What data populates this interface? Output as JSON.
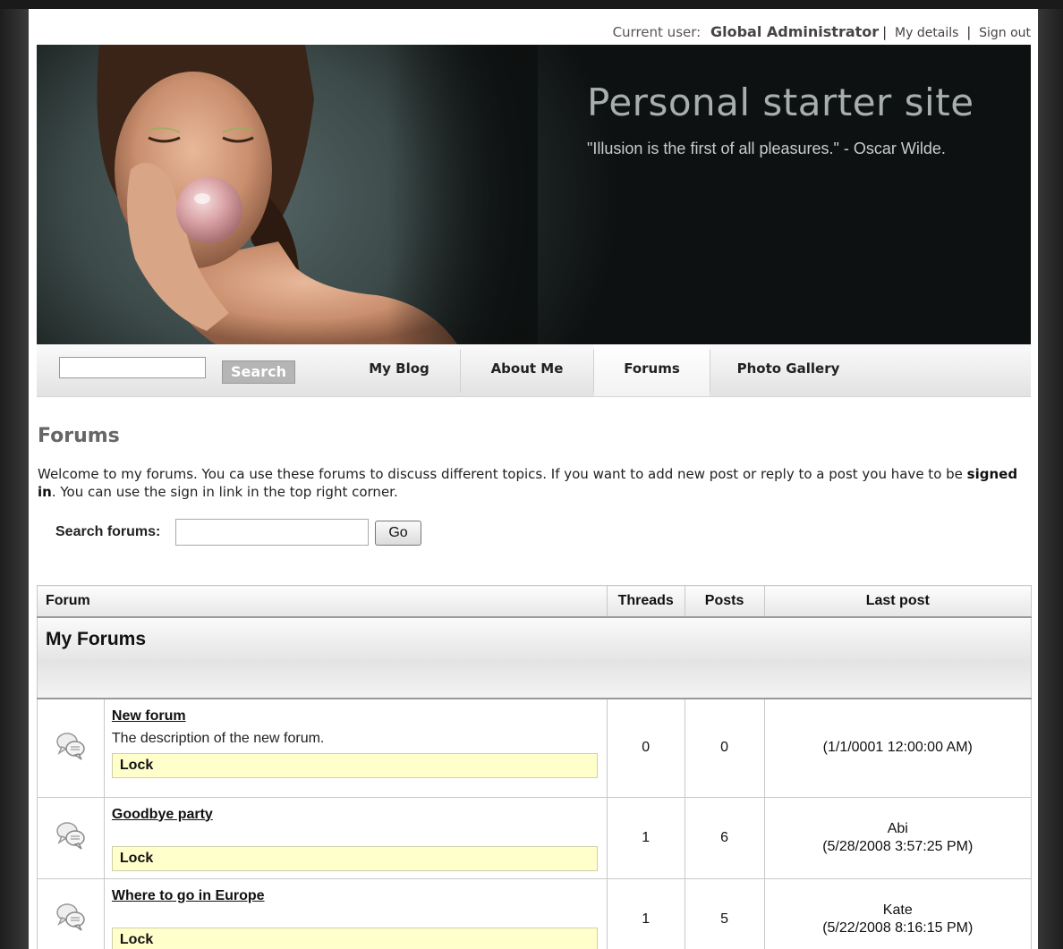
{
  "user_bar": {
    "current_user_label": "Current user:",
    "current_user_name": "Global Administrator",
    "my_details": "My details",
    "sign_out": "Sign out"
  },
  "banner": {
    "title": "Personal starter site",
    "quote": "\"Illusion is the first of all pleasures.\" - Oscar Wilde."
  },
  "nav": {
    "search_button": "Search",
    "items": [
      {
        "label": "My Blog"
      },
      {
        "label": "About Me"
      },
      {
        "label": "Forums"
      },
      {
        "label": "Photo Gallery"
      }
    ]
  },
  "page": {
    "heading": "Forums",
    "intro_pre": "Welcome to my forums. You ca use these forums to discuss different topics. If you want to add new post or reply to a post you have to be ",
    "intro_bold": "signed in",
    "intro_post": ". You can use the sign in link in the top right corner."
  },
  "search_forums": {
    "label": "Search forums:",
    "input_value": "",
    "go_button": "Go"
  },
  "table": {
    "headers": {
      "forum": "Forum",
      "threads": "Threads",
      "posts": "Posts",
      "last_post": "Last post"
    },
    "group": "My Forums",
    "rows": [
      {
        "name": "New forum",
        "description": "The description of the new forum.",
        "lock": "Lock",
        "threads": "0",
        "posts": "0",
        "last_user": "",
        "last_date": "(1/1/0001 12:00:00 AM)"
      },
      {
        "name": "Goodbye party",
        "description": "",
        "lock": "Lock",
        "threads": "1",
        "posts": "6",
        "last_user": "Abi",
        "last_date": "(5/28/2008 3:57:25 PM)"
      },
      {
        "name": "Where to go in Europe",
        "description": "",
        "lock": "Lock",
        "threads": "1",
        "posts": "5",
        "last_user": "Kate",
        "last_date": "(5/22/2008 8:16:15 PM)"
      }
    ],
    "forum_icon": "chat-bubbles-icon"
  }
}
